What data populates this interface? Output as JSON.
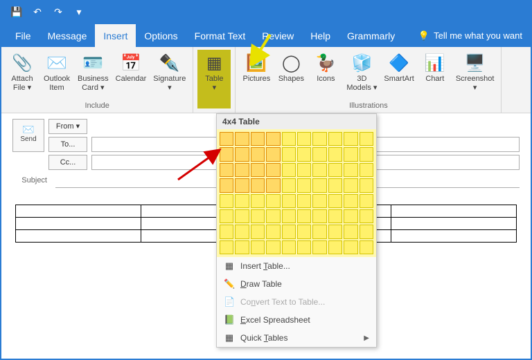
{
  "titlebar": {
    "save": "💾",
    "undo": "↶",
    "redo": "↷",
    "down": "▾"
  },
  "tabs": [
    "File",
    "Message",
    "Insert",
    "Options",
    "Format Text",
    "Review",
    "Help",
    "Grammarly"
  ],
  "activeTab": "Insert",
  "tell": "Tell me what you want",
  "ribbon": {
    "include": {
      "label": "Include",
      "items": [
        {
          "icon": "📎",
          "l1": "Attach",
          "l2": "File ▾"
        },
        {
          "icon": "✉️",
          "l1": "Outlook",
          "l2": "Item"
        },
        {
          "icon": "🪪",
          "l1": "Business",
          "l2": "Card ▾"
        },
        {
          "icon": "📅",
          "l1": "Calendar",
          "l2": ""
        },
        {
          "icon": "✒️",
          "l1": "Signature",
          "l2": "▾"
        }
      ]
    },
    "tables": {
      "label": "",
      "items": [
        {
          "icon": "▦",
          "l1": "Table",
          "l2": "▾"
        }
      ]
    },
    "illus": {
      "label": "Illustrations",
      "items": [
        {
          "icon": "🖼️",
          "l1": "Pictures",
          "l2": ""
        },
        {
          "icon": "◯",
          "l1": "Shapes",
          "l2": ""
        },
        {
          "icon": "🦆",
          "l1": "Icons",
          "l2": ""
        },
        {
          "icon": "🧊",
          "l1": "3D",
          "l2": "Models ▾"
        },
        {
          "icon": "🔷",
          "l1": "SmartArt",
          "l2": ""
        },
        {
          "icon": "📊",
          "l1": "Chart",
          "l2": ""
        },
        {
          "icon": "🖥️",
          "l1": "Screenshot",
          "l2": "▾"
        }
      ]
    }
  },
  "msg": {
    "send": "Send",
    "from": "From ▾",
    "to": "To...",
    "cc": "Cc...",
    "subject": "Subject"
  },
  "dropdown": {
    "header": "4x4 Table",
    "selRows": 4,
    "selCols": 4,
    "items": [
      {
        "icon": "▦",
        "label": "Insert Table...",
        "dis": false
      },
      {
        "icon": "✏️",
        "label": "Draw Table",
        "dis": false
      },
      {
        "icon": "📄",
        "label": "Convert Text to Table...",
        "dis": true
      },
      {
        "icon": "📗",
        "label": "Excel Spreadsheet",
        "dis": false
      },
      {
        "icon": "▦",
        "label": "Quick Tables",
        "dis": false,
        "sub": true
      }
    ],
    "underline": [
      7,
      0,
      2,
      0,
      6
    ]
  }
}
